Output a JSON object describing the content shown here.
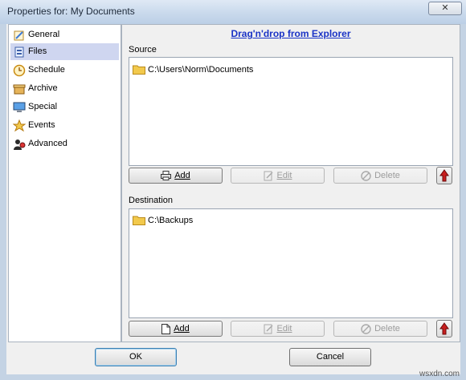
{
  "window": {
    "title": "Properties for: My Documents",
    "close_glyph": "✕"
  },
  "nav": {
    "items": [
      {
        "label": "General",
        "icon": "general-icon"
      },
      {
        "label": "Files",
        "icon": "files-icon",
        "selected": true
      },
      {
        "label": "Schedule",
        "icon": "clock-icon"
      },
      {
        "label": "Archive",
        "icon": "archive-icon"
      },
      {
        "label": "Special",
        "icon": "monitor-icon"
      },
      {
        "label": "Events",
        "icon": "events-icon"
      },
      {
        "label": "Advanced",
        "icon": "advanced-icon"
      }
    ]
  },
  "main": {
    "drag_link": "Drag'n'drop from Explorer",
    "source": {
      "label": "Source",
      "items": [
        "C:\\Users\\Norm\\Documents"
      ],
      "buttons": {
        "add": "Add",
        "edit": "Edit",
        "delete": "Delete"
      }
    },
    "destination": {
      "label": "Destination",
      "items": [
        "C:\\Backups"
      ],
      "buttons": {
        "add": "Add",
        "edit": "Edit",
        "delete": "Delete"
      }
    }
  },
  "footer": {
    "ok": "OK",
    "cancel": "Cancel"
  },
  "watermark": "wsxdn.com",
  "colors": {
    "link": "#1a33c6",
    "selected_bg": "#cfd6f0",
    "arrow_red": "#c81e1e",
    "folder": "#f2c94c"
  }
}
